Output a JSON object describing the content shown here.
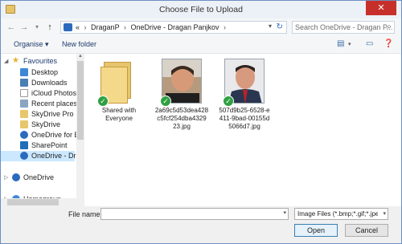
{
  "window": {
    "title": "Choose File to Upload",
    "close": "✕"
  },
  "nav": {
    "back": "←",
    "forward": "→",
    "recent": "▾",
    "up": "↑",
    "crumbs": [
      "«",
      "DraganP",
      "OneDrive - Dragan Panjkov"
    ],
    "search_placeholder": "Search OneDrive - Dragan P..."
  },
  "toolbar": {
    "organise": "Organise ▾",
    "new_folder": "New folder"
  },
  "sidebar": {
    "favourites": "Favourites",
    "items": [
      {
        "label": "Desktop"
      },
      {
        "label": "Downloads"
      },
      {
        "label": "iCloud Photos"
      },
      {
        "label": "Recent places"
      },
      {
        "label": "SkyDrive Pro"
      },
      {
        "label": "SkyDrive"
      },
      {
        "label": "OneDrive for Bus"
      },
      {
        "label": "SharePoint"
      },
      {
        "label": "OneDrive - Dragan"
      }
    ],
    "onedrive": "OneDrive",
    "homegroup": "Homegroup"
  },
  "files": [
    {
      "name": "Shared with\nEveryone",
      "type": "folder"
    },
    {
      "name": "2a69c5d53dea428\nc5fcf254dba4329\n23.jpg",
      "type": "photo"
    },
    {
      "name": "507d9b25-6528-e\n411-9bad-00155d\n5066d7.jpg",
      "type": "photo"
    }
  ],
  "bottom": {
    "filename_label": "File name:",
    "filename_value": "",
    "filter": "Image Files (*.bmp;*.gif;*.jpe;*.j",
    "open": "Open",
    "cancel": "Cancel"
  }
}
